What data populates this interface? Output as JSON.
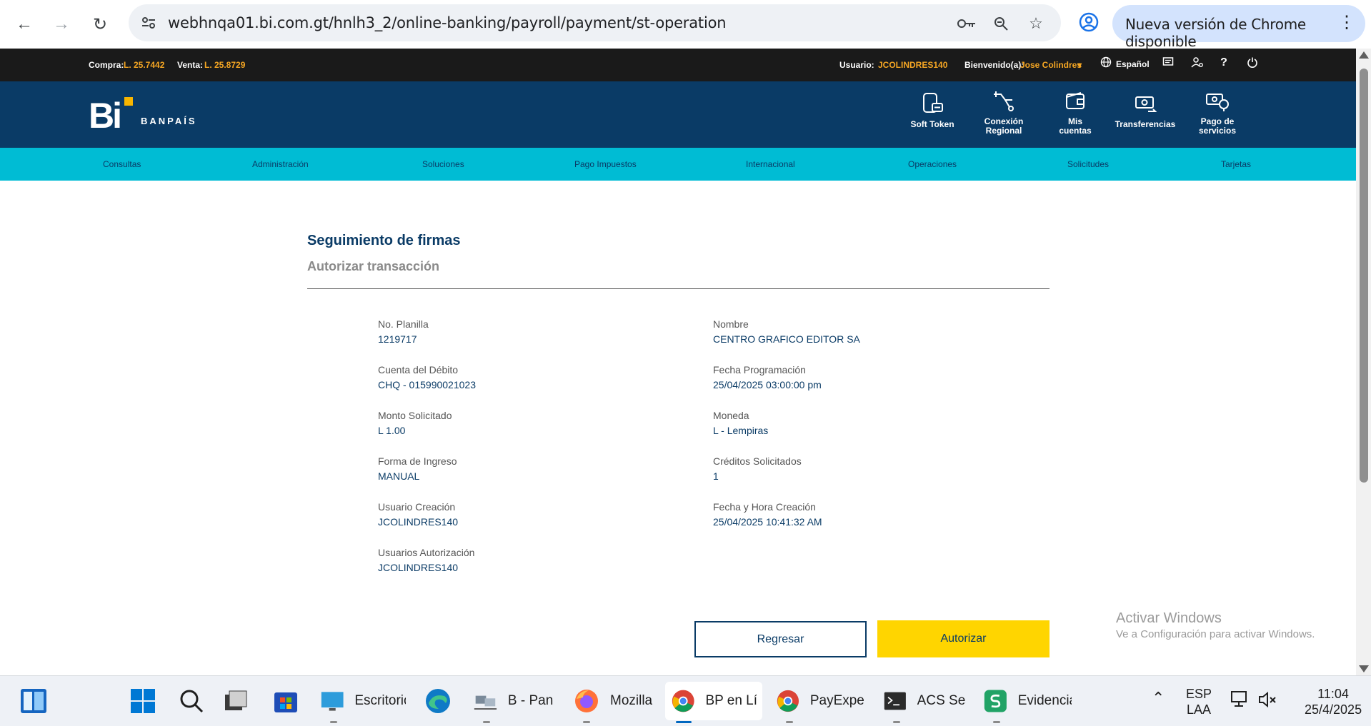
{
  "browser": {
    "url": "webhnqa01.bi.com.gt/hnlh3_2/online-banking/payroll/payment/st-operation",
    "update_label": "Nueva versión de Chrome disponible"
  },
  "topbar": {
    "compra_label": "Compra:",
    "compra_value": "L. 25.7442",
    "venta_label": "Venta:",
    "venta_value": "L. 25.8729",
    "usuario_label": "Usuario:",
    "usuario_value": "JCOLINDRES140",
    "bienvenido_label": "Bienvenido(a):",
    "bienvenido_value": "Jose Colindres",
    "language": "Español",
    "help": "?"
  },
  "header": {
    "logo_text": "Bi",
    "logo_name": "BANPAÍS",
    "buttons": [
      {
        "line1": "Soft Token",
        "line2": ""
      },
      {
        "line1": "Conexión",
        "line2": "Regional"
      },
      {
        "line1": "Mis",
        "line2": "cuentas"
      },
      {
        "line1": "Transferencias",
        "line2": ""
      },
      {
        "line1": "Pago de",
        "line2": "servicios"
      }
    ]
  },
  "menu": [
    "Consultas",
    "Administración",
    "Soluciones",
    "Pago Impuestos",
    "Internacional",
    "Operaciones",
    "Solicitudes",
    "Tarjetas"
  ],
  "content": {
    "title": "Seguimiento de firmas",
    "subtitle": "Autorizar transacción",
    "fields_left": [
      {
        "label": "No. Planilla",
        "value": "1219717"
      },
      {
        "label": "Cuenta del Débito",
        "value": "CHQ - 015990021023"
      },
      {
        "label": "Monto Solicitado",
        "value": "L 1.00"
      },
      {
        "label": "Forma de Ingreso",
        "value": "MANUAL"
      },
      {
        "label": "Usuario Creación",
        "value": "JCOLINDRES140"
      },
      {
        "label": "Usuarios Autorización",
        "value": "JCOLINDRES140"
      }
    ],
    "fields_right": [
      {
        "label": "Nombre",
        "value": "CENTRO GRAFICO EDITOR SA"
      },
      {
        "label": "Fecha Programación",
        "value": "25/04/2025 03:00:00 pm"
      },
      {
        "label": "Moneda",
        "value": "L - Lempiras"
      },
      {
        "label": "Créditos Solicitados",
        "value": "1"
      },
      {
        "label": "Fecha y Hora Creación",
        "value": "25/04/2025 10:41:32 AM"
      }
    ],
    "back_button": "Regresar",
    "authorize_button": "Autorizar"
  },
  "watermark": {
    "line1": "Activar Windows",
    "line2": "Ve a Configuración para activar Windows."
  },
  "taskbar": {
    "apps": [
      {
        "label": "Escritorio"
      },
      {
        "label": "B - Pant"
      },
      {
        "label": "Mozilla"
      },
      {
        "label": "BP en Lír"
      },
      {
        "label": "PayExpec"
      },
      {
        "label": "ACS Ses"
      },
      {
        "label": "Evidencia"
      }
    ],
    "lang_line1": "ESP",
    "lang_line2": "LAA",
    "time": "11:04",
    "date": "25/4/2025"
  },
  "colors": {
    "navy": "#0a3b66",
    "cyan": "#00bcd4",
    "yellow": "#ffd500",
    "orange": "#f5a623"
  }
}
